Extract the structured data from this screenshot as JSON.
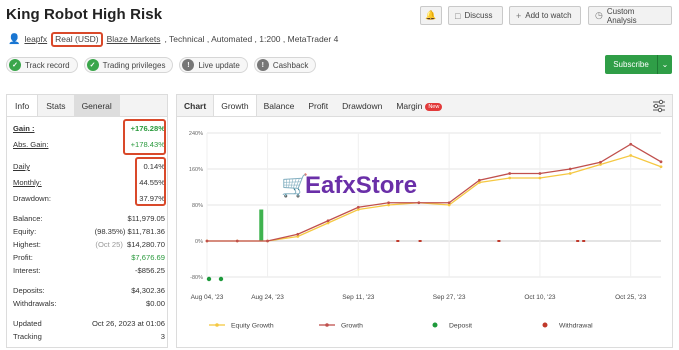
{
  "header": {
    "title": "King Robot High Risk",
    "buttons": {
      "discuss": "Discuss",
      "add_to_watch": "Add to watch",
      "custom_analysis": "Custom Analysis"
    }
  },
  "meta": {
    "user": "leapfx",
    "account_type": "Real (USD)",
    "broker": "Blaze Markets",
    "details": ", Technical , Automated , 1:200 , MetaTrader 4"
  },
  "badges": [
    {
      "label": "Track record",
      "status": "ok"
    },
    {
      "label": "Trading privileges",
      "status": "ok"
    },
    {
      "label": "Live update",
      "status": "off"
    },
    {
      "label": "Cashback",
      "status": "off"
    }
  ],
  "subscribe_label": "Subscribe",
  "left_tabs": [
    "Info",
    "Stats",
    "General"
  ],
  "stats": {
    "gain": {
      "label": "Gain :",
      "value": "+176.28%"
    },
    "abs_gain": {
      "label": "Abs. Gain:",
      "value": "+178.43%"
    },
    "daily": {
      "label": "Daily",
      "value": "0.14%"
    },
    "monthly": {
      "label": "Monthly:",
      "value": "44.55%"
    },
    "drawdown": {
      "label": "Drawdown:",
      "value": "37.97%"
    },
    "balance": {
      "label": "Balance:",
      "value": "$11,979.05"
    },
    "equity": {
      "label": "Equity:",
      "note": "(98.35%)",
      "value": "$11,781.36"
    },
    "highest": {
      "label": "Highest:",
      "note": "(Oct 25)",
      "value": "$14,280.70"
    },
    "profit": {
      "label": "Profit:",
      "value": "$7,676.69"
    },
    "interest": {
      "label": "Interest:",
      "value": "-$856.25"
    },
    "deposits": {
      "label": "Deposits:",
      "value": "$4,302.36"
    },
    "withdrawals": {
      "label": "Withdrawals:",
      "value": "$0.00"
    },
    "updated": {
      "label": "Updated",
      "value": "Oct 26, 2023 at 01:06"
    },
    "tracking": {
      "label": "Tracking",
      "value": "3"
    }
  },
  "chart_tabs": {
    "chart": "Chart",
    "growth": "Growth",
    "balance": "Balance",
    "profit": "Profit",
    "drawdown": "Drawdown",
    "margin": "Margin",
    "new_badge": "New"
  },
  "watermark": "EafxStore",
  "colors": {
    "green": "#2f9e47",
    "red_box": "#d9492a",
    "equity_line": "#f5c842",
    "growth_line": "#c0504d",
    "deposit": "#1e9a3c",
    "withdrawal": "#c0392b"
  },
  "chart_data": {
    "type": "line",
    "x": [
      "Aug 04, '23",
      "Aug 14, '23",
      "Aug 24, '23",
      "Sep 01, '23",
      "Sep 06, '23",
      "Sep 11, '23",
      "Sep 16, '23",
      "Sep 22, '23",
      "Sep 27, '23",
      "Oct 02, '23",
      "Oct 07, '23",
      "Oct 10, '23",
      "Oct 15, '23",
      "Oct 20, '23",
      "Oct 25, '23",
      "Oct 26, '23"
    ],
    "xticks": [
      "Aug 04, '23",
      "Aug 24, '23",
      "Sep 11, '23",
      "Sep 27, '23",
      "Oct 10, '23",
      "Oct 25, '23"
    ],
    "yticks": [
      "240%",
      "160%",
      "80%",
      "0%",
      "-80%"
    ],
    "ylim": [
      -80,
      240
    ],
    "series": [
      {
        "name": "Equity Growth",
        "values": [
          0,
          0,
          0,
          10,
          40,
          70,
          80,
          85,
          80,
          130,
          140,
          140,
          150,
          170,
          190,
          165
        ]
      },
      {
        "name": "Growth",
        "values": [
          0,
          0,
          0,
          15,
          45,
          75,
          85,
          85,
          85,
          135,
          150,
          150,
          160,
          175,
          215,
          176
        ]
      }
    ],
    "markers": [
      {
        "name": "Deposit",
        "color": "#1e9a3c"
      },
      {
        "name": "Withdrawal",
        "color": "#c0392b"
      }
    ],
    "grid": true,
    "legend": "bottom"
  }
}
